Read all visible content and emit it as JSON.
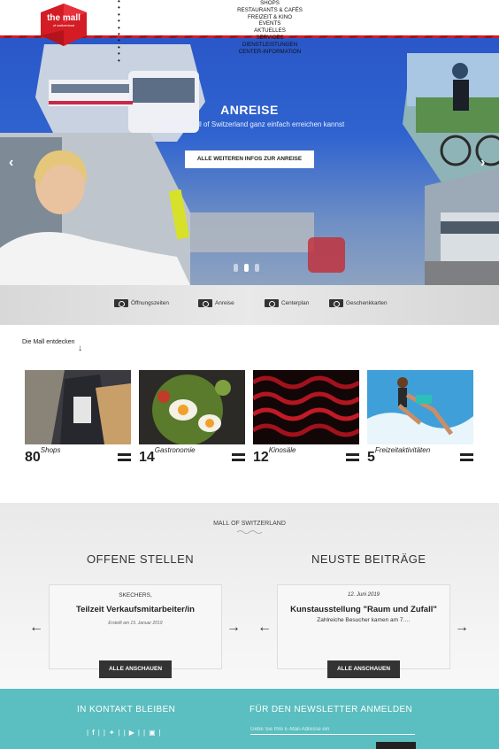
{
  "header": {
    "logo": {
      "line1": "the mall",
      "line2": "of switzerland"
    },
    "nav": [
      "Shops",
      "Restaurants & Cafés",
      "Freizeit & Kino",
      "Events",
      "Aktuelles",
      "Services",
      "Dienstleistungen",
      "Center-Information"
    ],
    "bullet_count": 10
  },
  "hero": {
    "title": "ANREISE",
    "subtitle": "wie du die Mall of Switzerland ganz einfach erreichen kannst",
    "button": "Alle weiteren Infos zur Anreise",
    "active_slide": 2,
    "slide_count": 3
  },
  "quick_links": [
    {
      "label": "Öffnungszeiten",
      "icon": "clock-icon"
    },
    {
      "label": "Anreise",
      "icon": "location-pin-icon"
    },
    {
      "label": "Centerplan",
      "icon": "map-icon"
    },
    {
      "label": "Geschenkkarten",
      "icon": "gift-icon"
    }
  ],
  "discover": {
    "title": "Die Mall entdecken",
    "cards": [
      {
        "number": "80",
        "label": "Shops"
      },
      {
        "number": "14",
        "label": "Gastronomie"
      },
      {
        "number": "12",
        "label": "Kinosäle"
      },
      {
        "number": "5",
        "label": "Freizeitaktivitäten"
      }
    ]
  },
  "mall": {
    "title": "Mall of Switzerland",
    "jobs": {
      "heading": "Offene Stellen",
      "company": "Skechers,",
      "title": "Teilzeit Verkaufsmitarbeiter/in",
      "meta": "Erstellt am 15. Januar 2019",
      "button": "Alle anschauen"
    },
    "posts": {
      "heading": "Neuste Beiträge",
      "date": "12. Juni 2019",
      "title": "Kunstausstellung \"Raum und Zufall\"",
      "excerpt": "Zahlreiche Besucher kamen am 7.…",
      "button": "Alle anschauen"
    }
  },
  "footer": {
    "contact_heading": "In Kontakt bleiben",
    "newsletter_heading": "Für den Newsletter anmelden",
    "newsletter_placeholder": "Gebe Sie Ihre E-Mail-Adresse ein",
    "social": [
      "facebook-icon",
      "twitter-icon",
      "youtube-icon",
      "instagram-icon"
    ]
  },
  "colors": {
    "brand_red": "#d41c24",
    "hero_blue": "#2f63cf",
    "footer_teal": "#5bbec0"
  }
}
